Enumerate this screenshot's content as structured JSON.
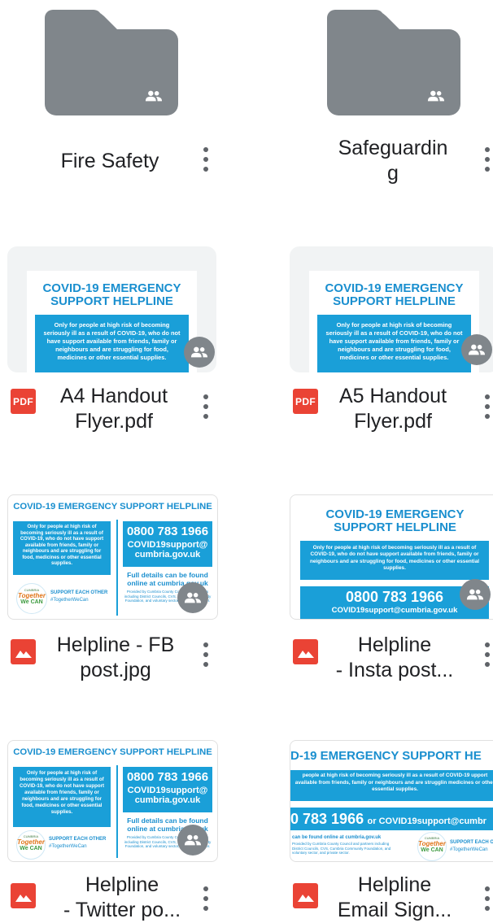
{
  "items": [
    {
      "name": "Fire Safety",
      "type": "folder",
      "shared": true
    },
    {
      "name": "Safeguardin\ng",
      "type": "folder",
      "shared": true
    },
    {
      "name": "A4 Handout\nFlyer.pdf",
      "type": "pdf",
      "icon": "pdf-icon",
      "icon_label": "PDF",
      "shared": true
    },
    {
      "name": "A5 Handout\nFlyer.pdf",
      "type": "pdf",
      "icon": "pdf-icon",
      "icon_label": "PDF",
      "shared": true
    },
    {
      "name": "Helpline - FB\npost.jpg",
      "type": "image",
      "icon": "image-icon",
      "shared": true
    },
    {
      "name": "Helpline\n- Insta post...",
      "type": "image",
      "icon": "image-icon",
      "shared": true
    },
    {
      "name": "Helpline\n- Twitter po...",
      "type": "image",
      "icon": "image-icon",
      "shared": true
    },
    {
      "name": "Helpline\nEmail Sign...",
      "type": "image",
      "icon": "image-icon",
      "shared": false
    }
  ],
  "flyer": {
    "title_line1": "COVID-19 EMERGENCY",
    "title_line2": "SUPPORT HELPLINE",
    "title_one_line": "COVID-19 EMERGENCY SUPPORT HELPLINE",
    "title_cropped": "D-19 EMERGENCY SUPPORT HE",
    "body": "Only for people at high risk of becoming seriously ill as a result of COVID-19, who do not have support available from friends, family or neighbours and are struggling for food, medicines or other essential supplies.",
    "body_cropped": "people at high risk of becoming seriously ill as a result of COVID-19 upport available from friends, family or neighbours and are strugglin medicines or other essential supplies.",
    "phone": "0800 783 1966",
    "phone_cropped": "0 783 1966",
    "email": "COVID19support@cumbria.gov.uk",
    "email_line1": "COVID19support@",
    "email_line2": "cumbria.gov.uk",
    "email_cropped": "or COVID19support@cumbr",
    "details1": "Full details can be found",
    "details2": "online at cumbria.gov.uk",
    "details_cropped": "can be found online at cumbria.gov.uk",
    "provided": "Provided by Cumbria County Council and partners including District Councils, CVS, Cumbria Community Foundation, and voluntary sector, and private sector.",
    "support_each_other": "SUPPORT EACH OTHER",
    "hashtag": "#TogetherWeCan",
    "logo_top": "CUMBRIA",
    "logo_main": "Together",
    "logo_sub": "We CAN"
  },
  "colors": {
    "accent": "#1a9fd8",
    "pdf_red": "#ea4335",
    "folder_grey": "#80868b",
    "dots": "#5f6368"
  }
}
